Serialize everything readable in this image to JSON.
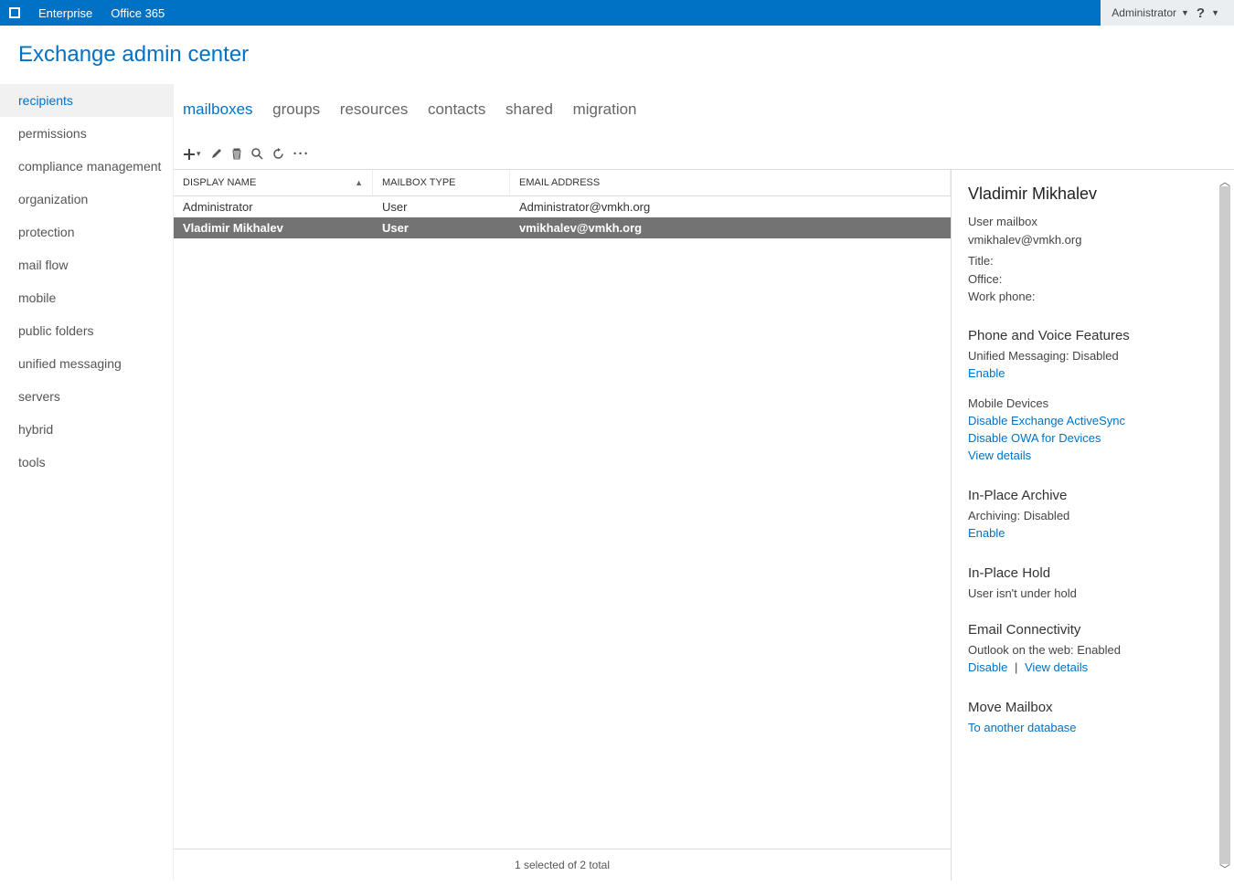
{
  "topbar": {
    "enterprise": "Enterprise",
    "office365": "Office 365",
    "admin": "Administrator",
    "help": "?"
  },
  "page_title": "Exchange admin center",
  "sidebar": {
    "items": [
      {
        "label": "recipients",
        "active": true
      },
      {
        "label": "permissions"
      },
      {
        "label": "compliance management"
      },
      {
        "label": "organization"
      },
      {
        "label": "protection"
      },
      {
        "label": "mail flow"
      },
      {
        "label": "mobile"
      },
      {
        "label": "public folders"
      },
      {
        "label": "unified messaging"
      },
      {
        "label": "servers"
      },
      {
        "label": "hybrid"
      },
      {
        "label": "tools"
      }
    ]
  },
  "tabs": [
    {
      "label": "mailboxes",
      "active": true
    },
    {
      "label": "groups"
    },
    {
      "label": "resources"
    },
    {
      "label": "contacts"
    },
    {
      "label": "shared"
    },
    {
      "label": "migration"
    }
  ],
  "columns": {
    "display_name": "DISPLAY NAME",
    "mailbox_type": "MAILBOX TYPE",
    "email_address": "EMAIL ADDRESS"
  },
  "rows": [
    {
      "name": "Administrator",
      "type": "User",
      "email": "Administrator@vmkh.org",
      "selected": false
    },
    {
      "name": "Vladimir Mikhalev",
      "type": "User",
      "email": "vmikhalev@vmkh.org",
      "selected": true
    }
  ],
  "details": {
    "name": "Vladimir Mikhalev",
    "subtype": "User mailbox",
    "email": "vmikhalev@vmkh.org",
    "title_label": "Title:",
    "office_label": "Office:",
    "workphone_label": "Work phone:",
    "phone_voice_h": "Phone and Voice Features",
    "um_label": "Unified Messaging:  Disabled",
    "enable1": "Enable",
    "mobile_devices_label": "Mobile Devices",
    "disable_eas": "Disable Exchange ActiveSync",
    "disable_owa": "Disable OWA for Devices",
    "view_details1": "View details",
    "archive_h": "In-Place Archive",
    "archiving_label": "Archiving:  Disabled",
    "enable2": "Enable",
    "hold_h": "In-Place Hold",
    "hold_status": "User isn't under hold",
    "email_conn_h": "Email Connectivity",
    "owaweb_label": "Outlook on the web:  Enabled",
    "disable_link": "Disable",
    "view_details2": "View details",
    "move_h": "Move Mailbox",
    "to_another_db": "To another database"
  },
  "footer": "1 selected of 2 total"
}
